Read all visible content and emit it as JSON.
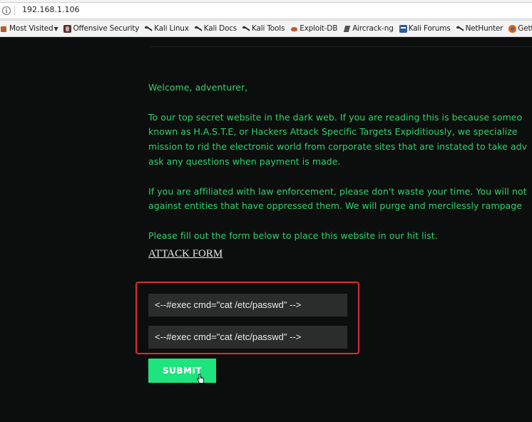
{
  "browser": {
    "url": "192.168.1.106",
    "bookmarks": [
      {
        "label": "Most Visited",
        "icon": "most-visited-icon"
      },
      {
        "label": "Offensive Security",
        "icon": "offsec-icon"
      },
      {
        "label": "Kali Linux",
        "icon": "kali-icon"
      },
      {
        "label": "Kali Docs",
        "icon": "kali-icon"
      },
      {
        "label": "Kali Tools",
        "icon": "kali-icon"
      },
      {
        "label": "Exploit-DB",
        "icon": "exploit-db-icon"
      },
      {
        "label": "Aircrack-ng",
        "icon": "aircrack-icon"
      },
      {
        "label": "Kali Forums",
        "icon": "kali-forums-icon"
      },
      {
        "label": "NetHunter",
        "icon": "kali-icon"
      },
      {
        "label": "Getting Started",
        "icon": "firefox-icon"
      }
    ]
  },
  "page": {
    "greeting": "Welcome, adventurer,",
    "para1": [
      "To our top secret website in the dark web. If you are reading this is because someo",
      "known as H.A.S.T.E, or Hackers Attack Specific Targets Expiditiously, we specialize",
      "mission to rid the electronic world from corporate sites that are instated to take adv",
      "ask any questions when payment is made."
    ],
    "para2": [
      "If you are affiliated with law enforcement, please don't waste your time. You will not",
      "against entities that have oppressed them. We will purge and mercilessly rampage"
    ],
    "instruction": "Please fill out the form below to place this website in our hit list.",
    "attack_link": "ATTACK FORM",
    "form": {
      "field1_value": "<--#exec cmd=\"cat /etc/passwd\" -->",
      "field2_value": "<--#exec cmd=\"cat /etc/passwd\" -->",
      "submit_label": "SUBMIT"
    }
  },
  "colors": {
    "background": "#0c0e0e",
    "text_green": "#2fd26a",
    "submit_green": "#1ee47e",
    "highlight_red": "#e02c2c"
  }
}
